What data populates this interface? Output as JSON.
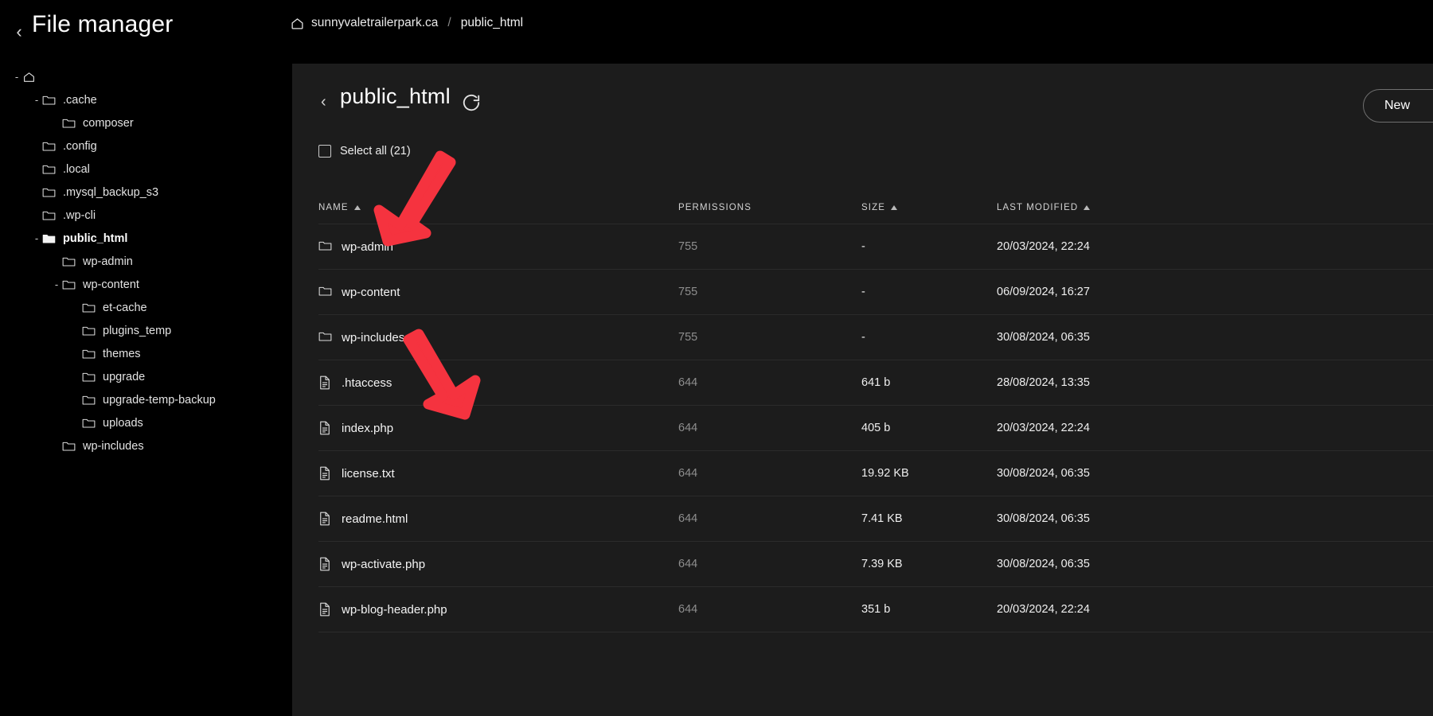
{
  "header": {
    "back_label": "‹",
    "title": "File manager",
    "breadcrumb": {
      "home_icon": "home-icon",
      "domain": "sunnyvaletrailerpark.ca",
      "separator": "/",
      "current": "public_html"
    }
  },
  "sidebar": {
    "items": [
      {
        "label": "",
        "icon": "home-icon",
        "depth": 0,
        "toggle": "-",
        "active": false
      },
      {
        "label": ".cache",
        "icon": "folder-icon",
        "depth": 1,
        "toggle": "-",
        "active": false
      },
      {
        "label": "composer",
        "icon": "folder-icon",
        "depth": 2,
        "toggle": "",
        "active": false
      },
      {
        "label": ".config",
        "icon": "folder-icon",
        "depth": 1,
        "toggle": "",
        "active": false
      },
      {
        "label": ".local",
        "icon": "folder-icon",
        "depth": 1,
        "toggle": "",
        "active": false
      },
      {
        "label": ".mysql_backup_s3",
        "icon": "folder-icon",
        "depth": 1,
        "toggle": "",
        "active": false
      },
      {
        "label": ".wp-cli",
        "icon": "folder-icon",
        "depth": 1,
        "toggle": "",
        "active": false
      },
      {
        "label": "public_html",
        "icon": "folder-open-icon",
        "depth": 1,
        "toggle": "-",
        "active": true
      },
      {
        "label": "wp-admin",
        "icon": "folder-icon",
        "depth": 2,
        "toggle": "",
        "active": false
      },
      {
        "label": "wp-content",
        "icon": "folder-icon",
        "depth": 2,
        "toggle": "-",
        "active": false
      },
      {
        "label": "et-cache",
        "icon": "folder-icon",
        "depth": 3,
        "toggle": "",
        "active": false
      },
      {
        "label": "plugins_temp",
        "icon": "folder-icon",
        "depth": 3,
        "toggle": "",
        "active": false
      },
      {
        "label": "themes",
        "icon": "folder-icon",
        "depth": 3,
        "toggle": "",
        "active": false
      },
      {
        "label": "upgrade",
        "icon": "folder-icon",
        "depth": 3,
        "toggle": "",
        "active": false
      },
      {
        "label": "upgrade-temp-backup",
        "icon": "folder-icon",
        "depth": 3,
        "toggle": "",
        "active": false
      },
      {
        "label": "uploads",
        "icon": "folder-icon",
        "depth": 3,
        "toggle": "",
        "active": false
      },
      {
        "label": "wp-includes",
        "icon": "folder-icon",
        "depth": 2,
        "toggle": "",
        "active": false
      }
    ]
  },
  "panel": {
    "back_label": "‹",
    "title": "public_html",
    "refresh_icon": "refresh-icon",
    "new_button": "New",
    "select_all": "Select all (21)",
    "columns": [
      {
        "label": "NAME",
        "sorted": true
      },
      {
        "label": "PERMISSIONS",
        "sorted": false
      },
      {
        "label": "SIZE",
        "sorted": true
      },
      {
        "label": "LAST MODIFIED",
        "sorted": true
      }
    ],
    "rows": [
      {
        "icon": "folder-icon",
        "name": "wp-admin",
        "permissions": "755",
        "size": "-",
        "modified": "20/03/2024, 22:24"
      },
      {
        "icon": "folder-icon",
        "name": "wp-content",
        "permissions": "755",
        "size": "-",
        "modified": "06/09/2024, 16:27"
      },
      {
        "icon": "folder-icon",
        "name": "wp-includes",
        "permissions": "755",
        "size": "-",
        "modified": "30/08/2024, 06:35"
      },
      {
        "icon": "file-icon",
        "name": ".htaccess",
        "permissions": "644",
        "size": "641 b",
        "modified": "28/08/2024, 13:35"
      },
      {
        "icon": "file-icon",
        "name": "index.php",
        "permissions": "644",
        "size": "405 b",
        "modified": "20/03/2024, 22:24"
      },
      {
        "icon": "file-icon",
        "name": "license.txt",
        "permissions": "644",
        "size": "19.92 KB",
        "modified": "30/08/2024, 06:35"
      },
      {
        "icon": "file-icon",
        "name": "readme.html",
        "permissions": "644",
        "size": "7.41 KB",
        "modified": "30/08/2024, 06:35"
      },
      {
        "icon": "file-icon",
        "name": "wp-activate.php",
        "permissions": "644",
        "size": "7.39 KB",
        "modified": "30/08/2024, 06:35"
      },
      {
        "icon": "file-icon",
        "name": "wp-blog-header.php",
        "permissions": "644",
        "size": "351 b",
        "modified": "20/03/2024, 22:24"
      }
    ]
  },
  "annotations": {
    "color": "#F5333F",
    "arrows": [
      {
        "name": "arrow-to-wp-admin",
        "target": "wp-admin"
      },
      {
        "name": "arrow-to-wp-includes",
        "target": "wp-includes"
      }
    ]
  },
  "colors": {
    "page_background": "#000000",
    "panel_background": "#1c1c1c",
    "text_primary": "#ffffff",
    "text_muted": "#8e8e8e",
    "row_divider": "#2b2b2b",
    "annotation_red": "#F5333F"
  }
}
